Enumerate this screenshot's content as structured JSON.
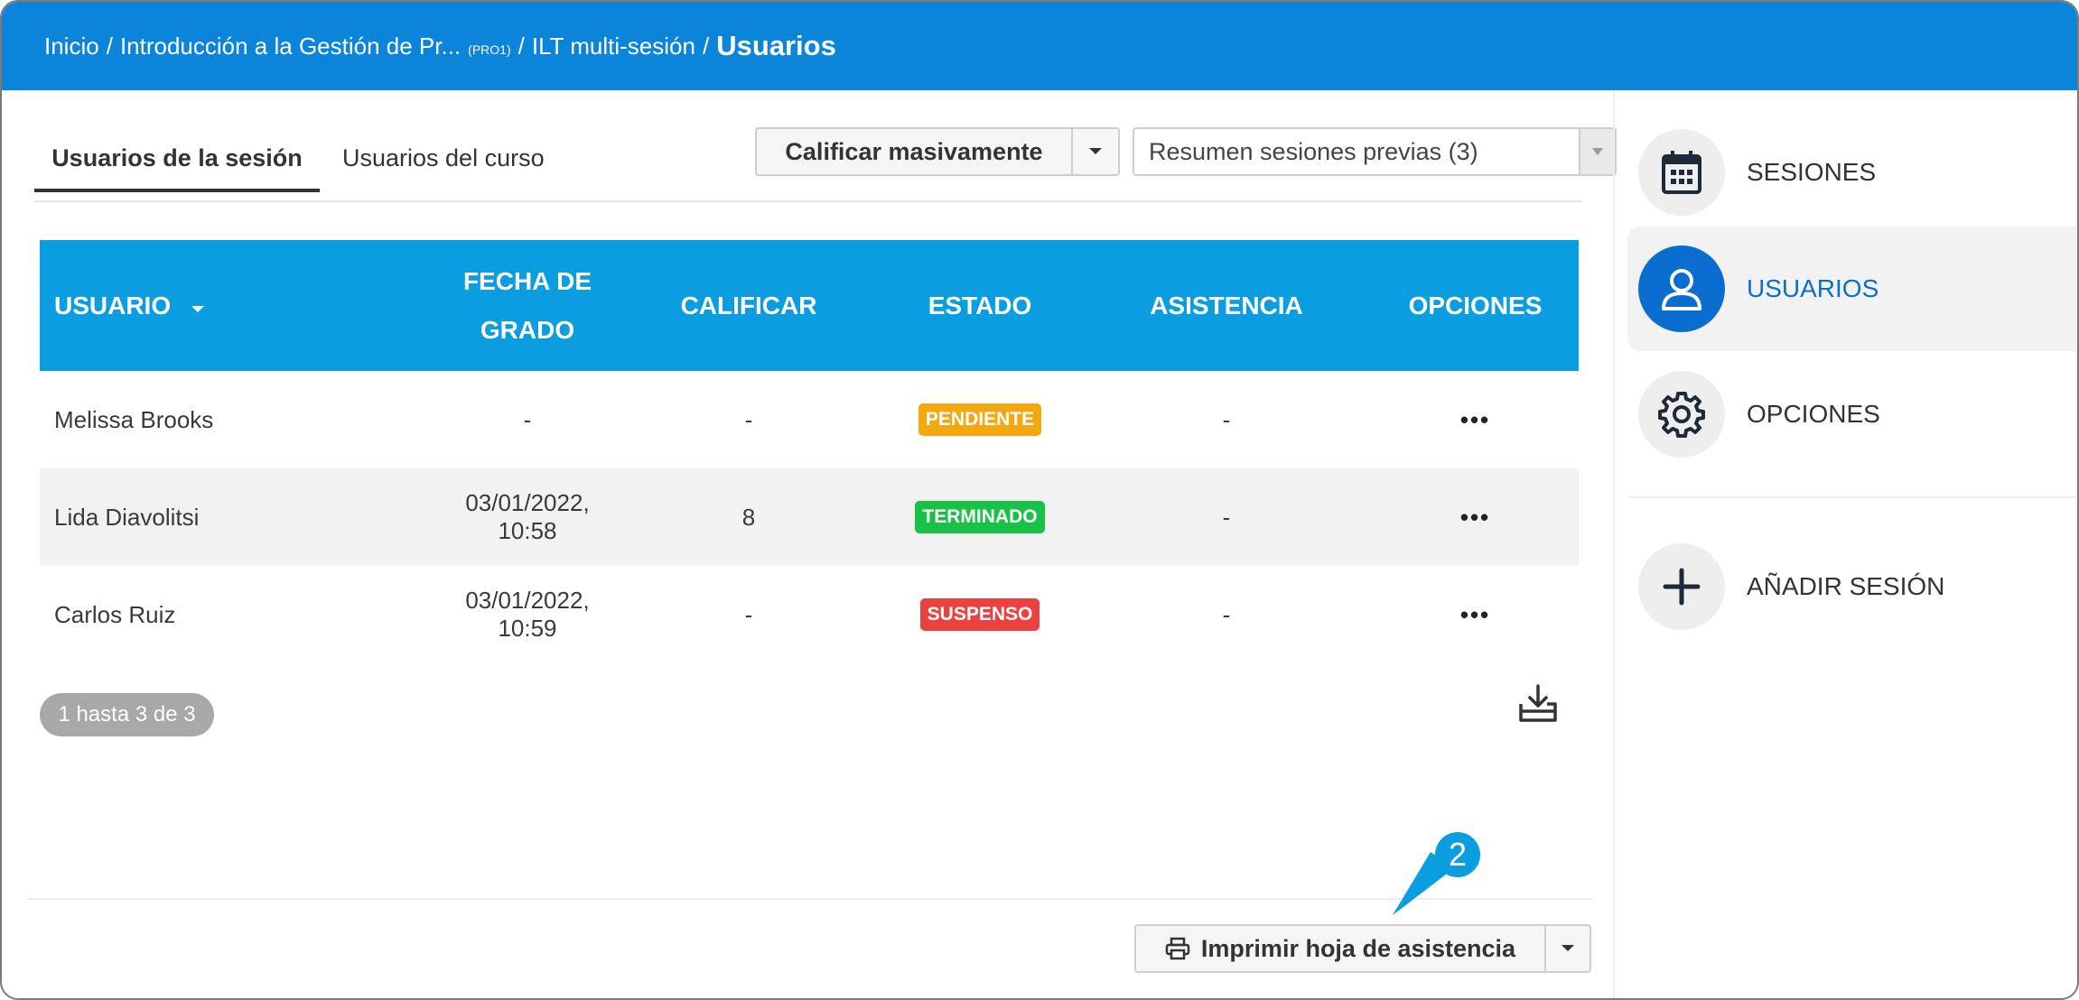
{
  "breadcrumb": {
    "home": "Inicio",
    "course": "Introducción a la Gestión de Pr...",
    "course_code": "(PRO1)",
    "session": "ILT multi-sesión",
    "current": "Usuarios"
  },
  "tabs": {
    "session_users": "Usuarios de la sesión",
    "course_users": "Usuarios del curso"
  },
  "toolbar": {
    "bulk_grade": "Calificar masivamente",
    "previous_sessions": "Resumen sesiones previas (3)"
  },
  "table": {
    "headers": {
      "user": "USUARIO",
      "grade_date_line1": "FECHA DE",
      "grade_date_line2": "GRADO",
      "grade": "CALIFICAR",
      "status": "ESTADO",
      "attendance": "ASISTENCIA",
      "options": "OPCIONES"
    },
    "rows": [
      {
        "user": "Melissa Brooks",
        "date": "-",
        "grade": "-",
        "status": "PENDIENTE",
        "attendance": "-",
        "options": "•••"
      },
      {
        "user": "Lida Diavolitsi",
        "date": "03/01/2022, 10:58",
        "grade": "8",
        "status": "TERMINADO",
        "attendance": "-",
        "options": "•••"
      },
      {
        "user": "Carlos Ruiz",
        "date": "03/01/2022, 10:59",
        "grade": "-",
        "status": "SUSPENSO",
        "attendance": "-",
        "options": "•••"
      }
    ]
  },
  "status_colors": {
    "PENDIENTE": "#f5a70f",
    "TERMINADO": "#18c247",
    "SUSPENSO": "#ec4141"
  },
  "pagination": "1 hasta 3 de 3",
  "footer": {
    "print_button": "Imprimir hoja de asistencia",
    "callout_number": "2"
  },
  "sidebar": {
    "sessions": "SESIONES",
    "users": "USUARIOS",
    "options": "OPCIONES",
    "add_session": "AÑADIR SESIÓN"
  },
  "colors": {
    "header": "#0a85d9",
    "table_header": "#0a9ee0",
    "active_accent": "#0a6ed1"
  },
  "icons": [
    "calendar-icon",
    "user-icon",
    "gear-icon",
    "plus-icon",
    "download-icon",
    "printer-icon",
    "caret-down-icon",
    "sort-caret-icon"
  ]
}
